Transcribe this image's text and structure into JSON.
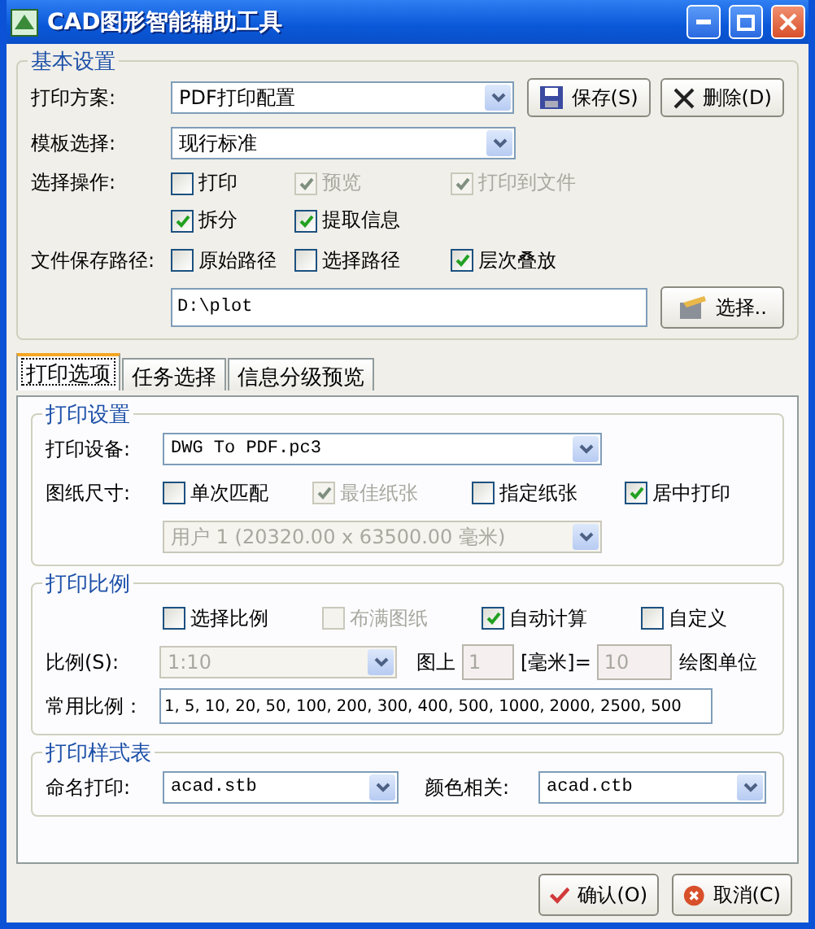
{
  "window": {
    "title": "CAD图形智能辅助工具"
  },
  "basic_settings": {
    "title": "基本设置",
    "plan": {
      "label": "打印方案:",
      "value": "PDF打印配置"
    },
    "save_button": "保存(S)",
    "delete_button": "删除(D)",
    "template": {
      "label": "模板选择:",
      "value": "现行标准"
    },
    "operations": {
      "label": "选择操作:",
      "options": [
        {
          "label": "打印",
          "checked": false,
          "disabled": false
        },
        {
          "label": "预览",
          "checked": true,
          "disabled": true
        },
        {
          "label": "打印到文件",
          "checked": true,
          "disabled": true
        },
        {
          "label": "拆分",
          "checked": true,
          "disabled": false
        },
        {
          "label": "提取信息",
          "checked": true,
          "disabled": false
        }
      ]
    },
    "save_path": {
      "label": "文件保存路径:",
      "options": [
        {
          "label": "原始路径",
          "checked": false,
          "disabled": false
        },
        {
          "label": "选择路径",
          "checked": false,
          "disabled": false
        },
        {
          "label": "层次叠放",
          "checked": true,
          "disabled": false
        }
      ],
      "value": "D:\\plot"
    },
    "browse_button": "选择.."
  },
  "tabs": [
    {
      "label": "打印选项",
      "selected": true
    },
    {
      "label": "任务选择",
      "selected": false
    },
    {
      "label": "信息分级预览",
      "selected": false
    }
  ],
  "print_settings": {
    "title": "打印设置",
    "device": {
      "label": "打印设备:",
      "value": "DWG To PDF.pc3"
    },
    "paper": {
      "label": "图纸尺寸:",
      "options": [
        {
          "label": "单次匹配",
          "checked": false,
          "disabled": false
        },
        {
          "label": "最佳纸张",
          "checked": true,
          "disabled": true
        },
        {
          "label": "指定纸张",
          "checked": false,
          "disabled": false
        },
        {
          "label": "居中打印",
          "checked": true,
          "disabled": false
        }
      ],
      "size": {
        "value": "用户 1 (20320.00 x 63500.00 毫米)",
        "disabled": true
      }
    }
  },
  "print_scale": {
    "title": "打印比例",
    "options": [
      {
        "label": "选择比例",
        "checked": false,
        "disabled": false
      },
      {
        "label": "布满图纸",
        "checked": false,
        "disabled": true
      },
      {
        "label": "自动计算",
        "checked": true,
        "disabled": false
      },
      {
        "label": "自定义",
        "checked": false,
        "disabled": false
      }
    ],
    "scale": {
      "label": "比例(S):",
      "value": "1:10",
      "disabled": true
    },
    "on_paper_label": "图上",
    "paper_units": {
      "value": "1",
      "disabled": true
    },
    "unit_label": "[毫米]=",
    "drawing_units": {
      "value": "10",
      "disabled": true
    },
    "drawing_units_label": "绘图单位",
    "common": {
      "label": "常用比例：",
      "value": "1, 5, 10, 20, 50, 100, 200, 300, 400, 500, 1000, 2000, 2500, 500"
    }
  },
  "plot_style": {
    "title": "打印样式表",
    "named": {
      "label": "命名打印:",
      "value": "acad.stb"
    },
    "color": {
      "label": "颜色相关:",
      "value": "acad.ctb"
    }
  },
  "buttons": [
    {
      "label": "确认(O)",
      "kind": "ok"
    },
    {
      "label": "取消(C)",
      "kind": "cancel"
    }
  ]
}
